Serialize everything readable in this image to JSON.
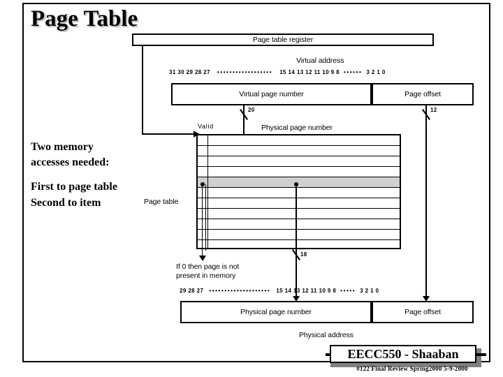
{
  "slide": {
    "title": "Page Table"
  },
  "notes": {
    "line1": "Two memory",
    "line2": "accesses needed:",
    "line3": "First to page table",
    "line4": "Second to item"
  },
  "diagram": {
    "page_table_register": "Page table register",
    "virtual_address_label": "Virtual address",
    "virtual_page_number": "Virtual page number",
    "page_offset_top": "Page offset",
    "vpn_bits": "20",
    "offset_bits_top": "12",
    "valid_label": "Valid",
    "physical_page_number_header": "Physical page number",
    "page_table_label": "Page table",
    "ppn_bits": "18",
    "invalid_note_line1": "If 0 then page is not",
    "invalid_note_line2": "present in memory",
    "physical_page_number": "Physical page number",
    "page_offset_bottom": "Page offset",
    "physical_address_label": "Physical address",
    "highlight_color": "#d0d0d0"
  },
  "bit_ruler_top": {
    "left_group": [
      "31",
      "30",
      "29",
      "28",
      "27"
    ],
    "mid_group": [
      "15",
      "14",
      "13",
      "12",
      "11",
      "10",
      "9",
      "8"
    ],
    "right_group": [
      "3",
      "2",
      "1",
      "0"
    ],
    "ellipsis_wide": "••••••••••••••••••",
    "ellipsis_narrow": "••••••"
  },
  "bit_ruler_bottom": {
    "left_group": [
      "29",
      "28",
      "27"
    ],
    "mid_group": [
      "15",
      "14",
      "13",
      "12",
      "11",
      "10",
      "9",
      "8"
    ],
    "right_group": [
      "3",
      "2",
      "1",
      "0"
    ],
    "ellipsis_wide": "••••••••••••••••••••",
    "ellipsis_narrow": "•••••"
  },
  "footer": {
    "course": "EECC550 - Shaaban",
    "subline": "#122   Final Review   Spring2000   5-9-2000"
  }
}
